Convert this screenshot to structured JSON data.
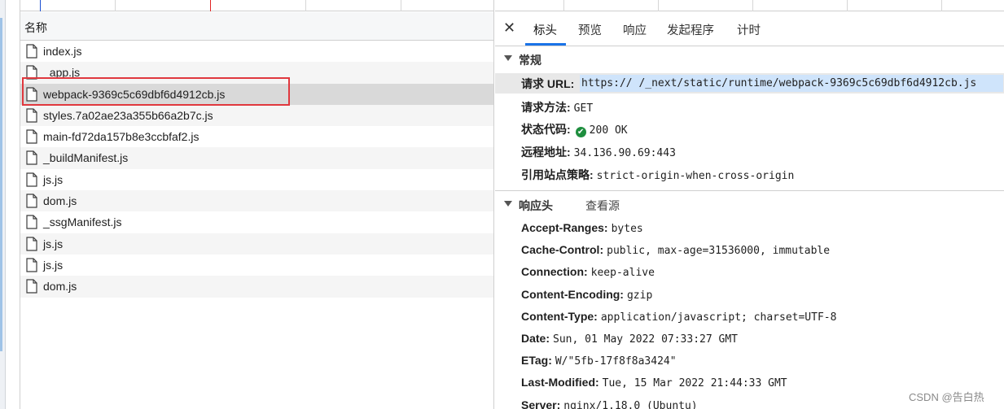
{
  "request_list": {
    "column_header": "名称",
    "files": [
      {
        "name": "index.js",
        "selected": false
      },
      {
        "name": "_app.js",
        "selected": false
      },
      {
        "name": "webpack-9369c5c69dbf6d4912cb.js",
        "selected": true
      },
      {
        "name": "styles.7a02ae23a355b66a2b7c.js",
        "selected": false
      },
      {
        "name": "main-fd72da157b8e3ccbfaf2.js",
        "selected": false
      },
      {
        "name": "_buildManifest.js",
        "selected": false
      },
      {
        "name": "js.js",
        "selected": false
      },
      {
        "name": "dom.js",
        "selected": false
      },
      {
        "name": "_ssgManifest.js",
        "selected": false
      },
      {
        "name": "js.js",
        "selected": false
      },
      {
        "name": "js.js",
        "selected": false
      },
      {
        "name": "dom.js",
        "selected": false
      }
    ]
  },
  "detail_panel": {
    "close_glyph": "✕",
    "tabs": [
      {
        "label": "标头",
        "active": true
      },
      {
        "label": "预览",
        "active": false
      },
      {
        "label": "响应",
        "active": false
      },
      {
        "label": "发起程序",
        "active": false
      },
      {
        "label": "计时",
        "active": false
      }
    ],
    "general": {
      "title": "常规",
      "request_url_key": "请求 URL:",
      "request_url_value": "https://                 /_next/static/runtime/webpack-9369c5c69dbf6d4912cb.js",
      "method_key": "请求方法:",
      "method_value": "GET",
      "status_key": "状态代码:",
      "status_value": "200 OK",
      "remote_key": "远程地址:",
      "remote_value": "34.136.90.69:443",
      "referrer_key": "引用站点策略:",
      "referrer_value": "strict-origin-when-cross-origin"
    },
    "response_headers": {
      "title": "响应头",
      "view_source": "查看源",
      "items": [
        {
          "key": "Accept-Ranges:",
          "value": "bytes"
        },
        {
          "key": "Cache-Control:",
          "value": "public, max-age=31536000, immutable"
        },
        {
          "key": "Connection:",
          "value": "keep-alive"
        },
        {
          "key": "Content-Encoding:",
          "value": "gzip"
        },
        {
          "key": "Content-Type:",
          "value": "application/javascript; charset=UTF-8"
        },
        {
          "key": "Date:",
          "value": "Sun, 01 May 2022 07:33:27 GMT"
        },
        {
          "key": "ETag:",
          "value": "W/\"5fb-17f8f8a3424\""
        },
        {
          "key": "Last-Modified:",
          "value": "Tue, 15 Mar 2022 21:44:33 GMT"
        },
        {
          "key": "Server:",
          "value": "nginx/1.18.0 (Ubuntu)"
        }
      ]
    }
  },
  "watermark": "CSDN @告白热",
  "colors": {
    "accent": "#1a73e8",
    "highlight_box": "#e0383e",
    "status_ok": "#1e8e3e",
    "url_selection": "#cfe4fb"
  }
}
